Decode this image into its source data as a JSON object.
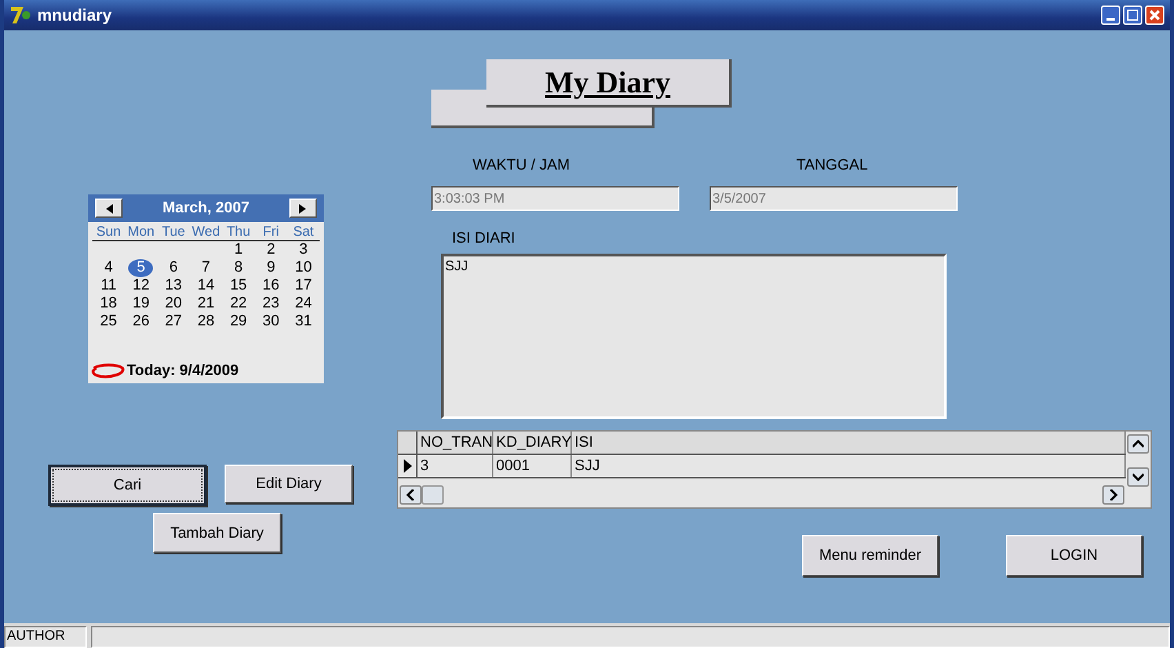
{
  "window": {
    "title": "mnudiary"
  },
  "banner": {
    "title": "My Diary"
  },
  "calendar": {
    "month_label": "March, 2007",
    "weekdays": [
      "Sun",
      "Mon",
      "Tue",
      "Wed",
      "Thu",
      "Fri",
      "Sat"
    ],
    "weeks": [
      [
        {
          "label": "1",
          "selected": false
        },
        {
          "label": "2",
          "selected": false
        },
        {
          "label": "3",
          "selected": false
        }
      ],
      [
        {
          "label": "4",
          "selected": false
        },
        {
          "label": "5",
          "selected": true
        },
        {
          "label": "6",
          "selected": false
        },
        {
          "label": "7",
          "selected": false
        },
        {
          "label": "8",
          "selected": false
        },
        {
          "label": "9",
          "selected": false
        },
        {
          "label": "10",
          "selected": false
        }
      ],
      [
        {
          "label": "11",
          "selected": false
        },
        {
          "label": "12",
          "selected": false
        },
        {
          "label": "13",
          "selected": false
        },
        {
          "label": "14",
          "selected": false
        },
        {
          "label": "15",
          "selected": false
        },
        {
          "label": "16",
          "selected": false
        },
        {
          "label": "17",
          "selected": false
        }
      ],
      [
        {
          "label": "18",
          "selected": false
        },
        {
          "label": "19",
          "selected": false
        },
        {
          "label": "20",
          "selected": false
        },
        {
          "label": "21",
          "selected": false
        },
        {
          "label": "22",
          "selected": false
        },
        {
          "label": "23",
          "selected": false
        },
        {
          "label": "24",
          "selected": false
        }
      ],
      [
        {
          "label": "25",
          "selected": false
        },
        {
          "label": "26",
          "selected": false
        },
        {
          "label": "27",
          "selected": false
        },
        {
          "label": "28",
          "selected": false
        },
        {
          "label": "29",
          "selected": false
        },
        {
          "label": "30",
          "selected": false
        },
        {
          "label": "31",
          "selected": false
        }
      ]
    ],
    "today": "Today: 9/4/2009"
  },
  "fields": [
    {
      "label": "WAKTU / JAM",
      "value": "3:03:03 PM"
    },
    {
      "label": "TANGGAL",
      "value": "3/5/2007"
    }
  ],
  "diary": {
    "label": "ISI DIARI",
    "value": "SJJ"
  },
  "grid": {
    "columns": [
      "NO_TRAN",
      "KD_DIARY",
      "ISI"
    ],
    "rows": [
      {
        "cells": [
          "3",
          "0001",
          "SJJ"
        ],
        "current": true
      }
    ]
  },
  "left_buttons": [
    {
      "label": "Cari",
      "focused": true
    },
    {
      "label": "Edit Diary",
      "focused": false
    },
    {
      "label": "Tambah Diary",
      "focused": false
    }
  ],
  "right_buttons": [
    {
      "label": "Menu reminder",
      "focused": false
    },
    {
      "label": "LOGIN",
      "focused": false
    }
  ],
  "status_bar": {
    "panel": "AUTHOR"
  }
}
